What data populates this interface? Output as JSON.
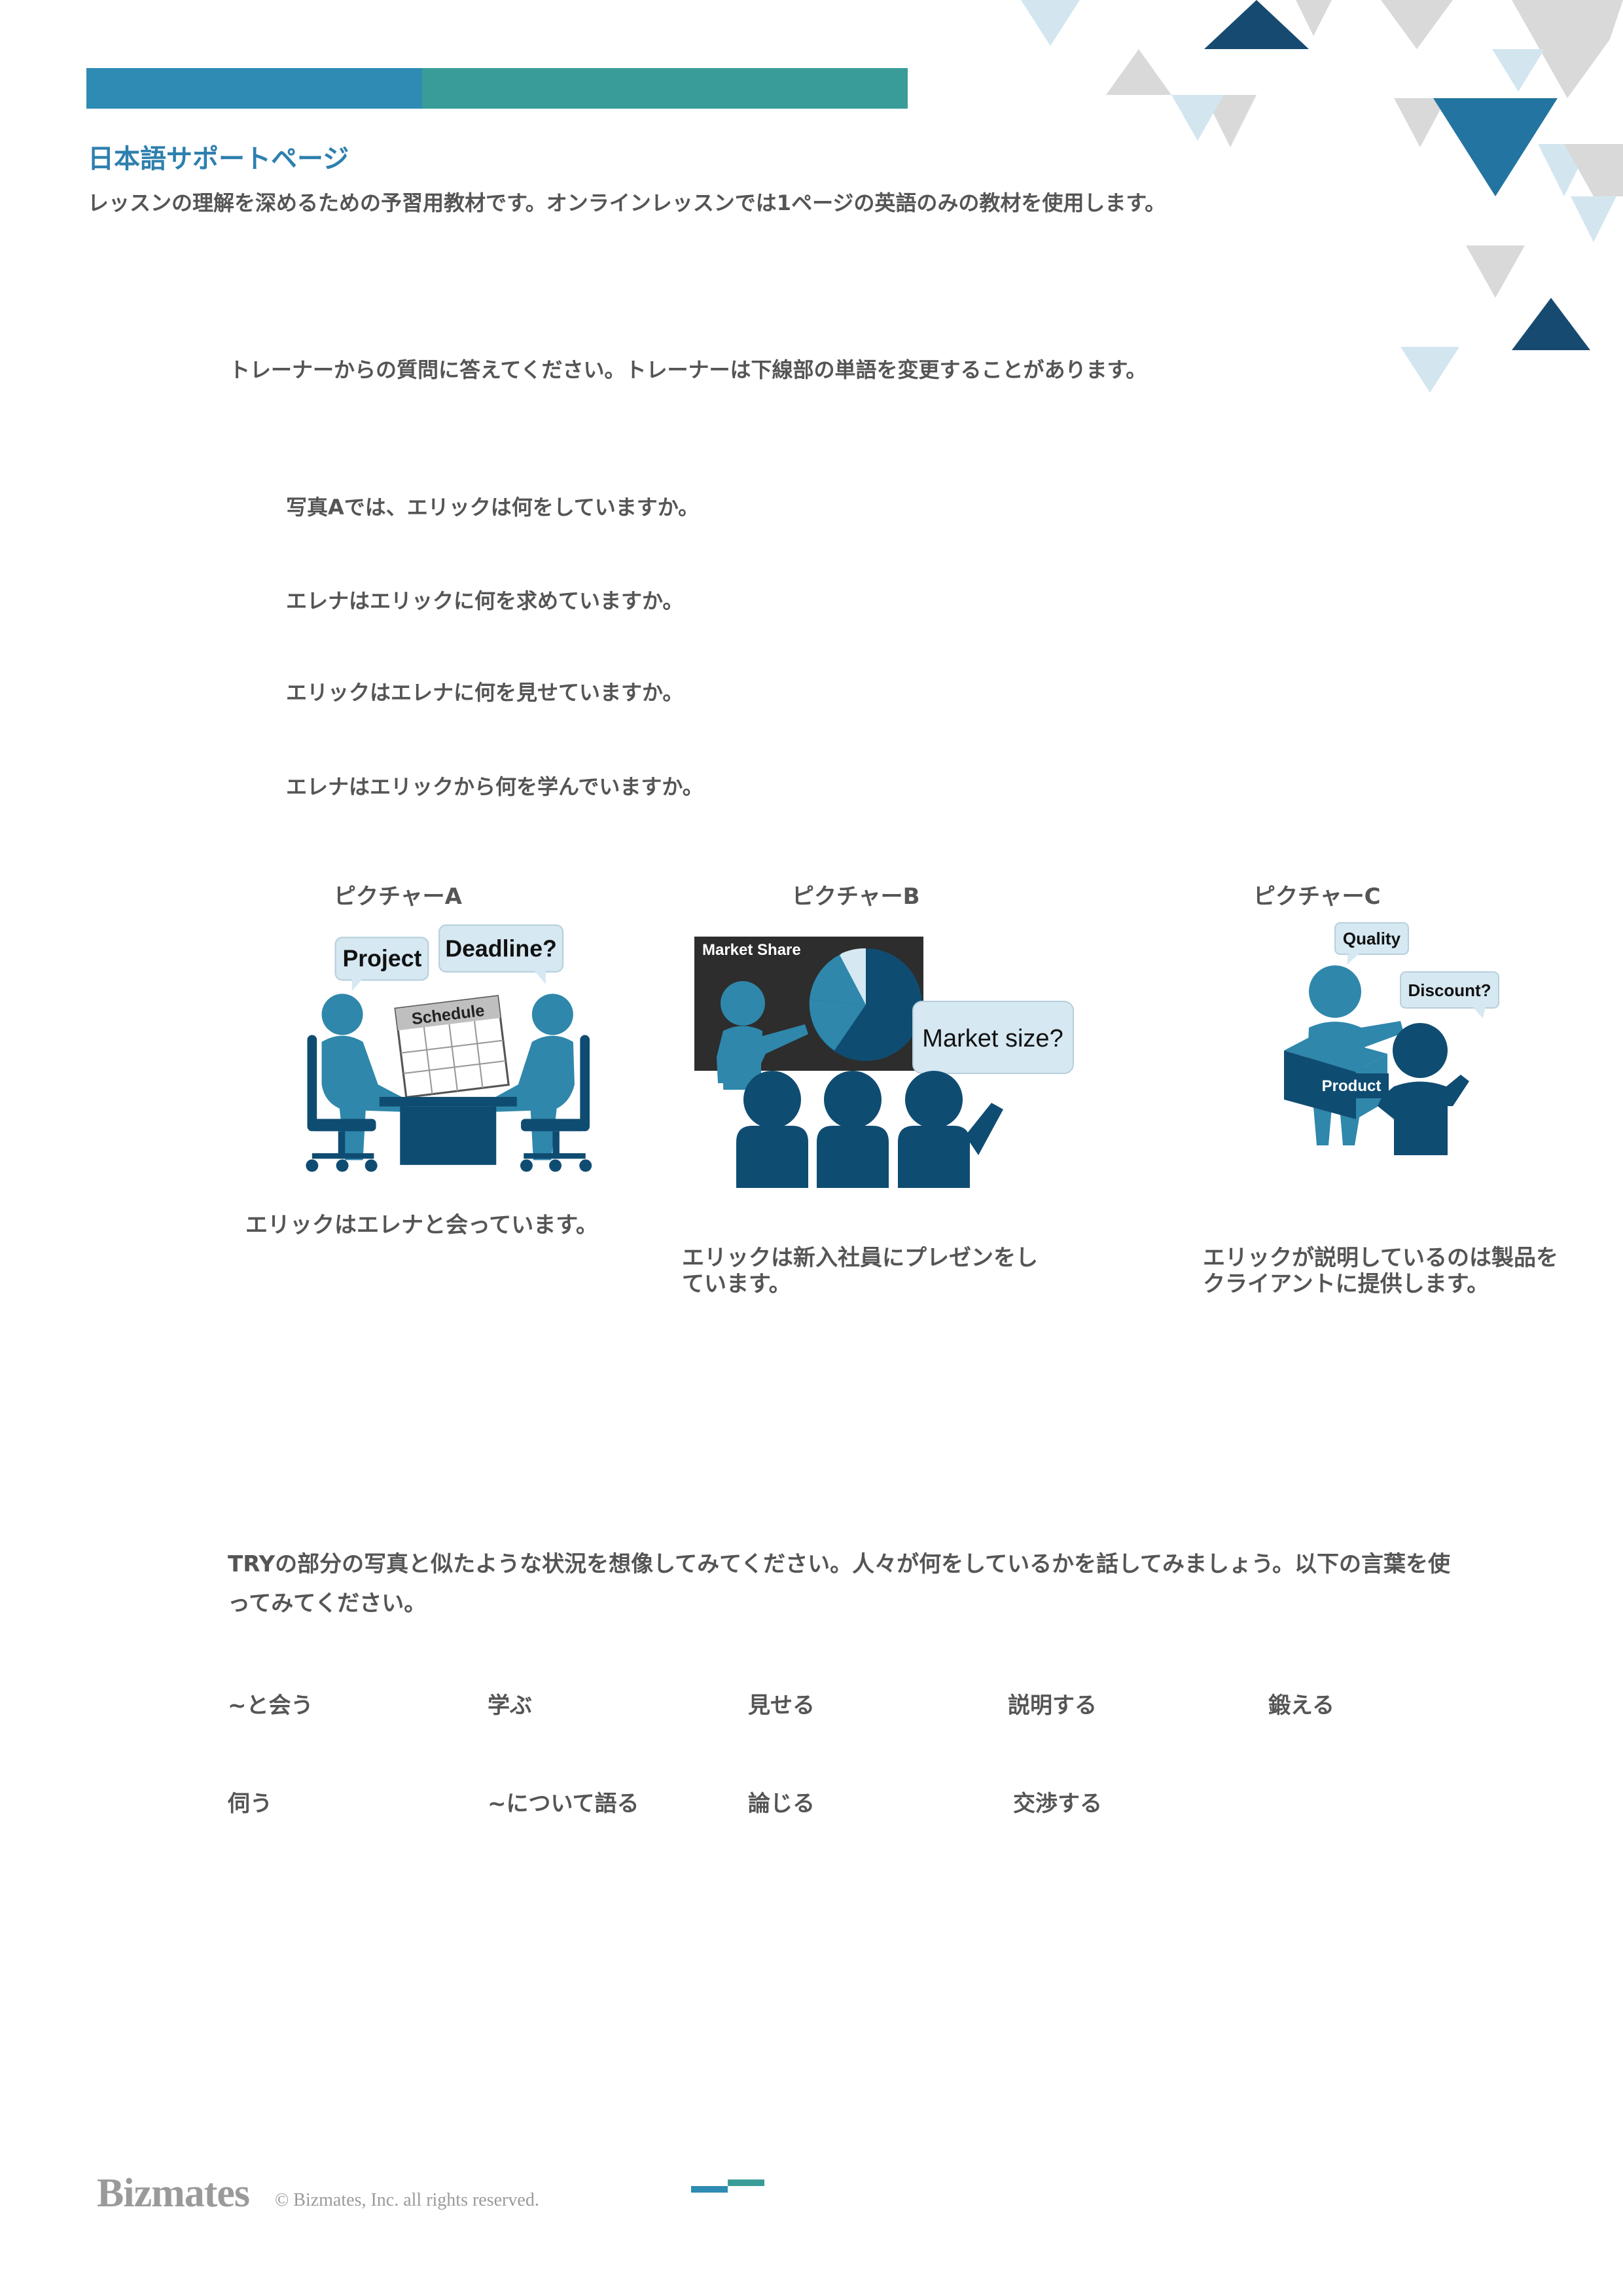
{
  "header": {
    "title": "日本語サポートページ",
    "subtitle": "レッスンの理解を深めるための予習用教材です。オンラインレッスンでは1ページの英語のみの教材を使用します。"
  },
  "instruction": "トレーナーからの質問に答えてください。トレーナーは下線部の単語を変更することがあります。",
  "questions": [
    "写真Aでは、エリックは何をしていますか。",
    "エレナはエリックに何を求めていますか。",
    "エリックはエレナに何を見せていますか。",
    "エレナはエリックから何を学んでいますか。"
  ],
  "pictures": [
    {
      "label": "ピクチャーA",
      "caption": "エリックはエレナと会っています。",
      "bubbles": [
        "Project",
        "Deadline?"
      ],
      "sign": "Schedule"
    },
    {
      "label": "ピクチャーB",
      "caption_lines": [
        "エリックは新入社員にプレゼンをし",
        "ています。"
      ],
      "board": "Market Share",
      "bubble": "Market size?"
    },
    {
      "label": "ピクチャーC",
      "caption_lines": [
        "エリックが説明しているのは製品を",
        "クライアントに提供します。"
      ],
      "bubbles": [
        "Quality",
        "Discount?"
      ],
      "box": "Product"
    }
  ],
  "try_text": "TRYの部分の写真と似たような状況を想像してみてください。人々が何をしているかを話してみましょう。以下の言葉を使ってみてください。",
  "words_row1": [
    "~と会う",
    "学ぶ",
    "見せる",
    "説明する",
    "鍛える"
  ],
  "words_row2": [
    "伺う",
    "~について語る",
    "論じる",
    "交渉する"
  ],
  "footer": {
    "logo": "Bizmates",
    "copyright": "© Bizmates, Inc. all rights reserved."
  },
  "colors": {
    "brand_blue": "#2e8bb3",
    "brand_teal": "#3a9c98",
    "navy": "#0f4c72",
    "figure_blue": "#2f87ab",
    "light_blue": "#d6e8f2"
  }
}
